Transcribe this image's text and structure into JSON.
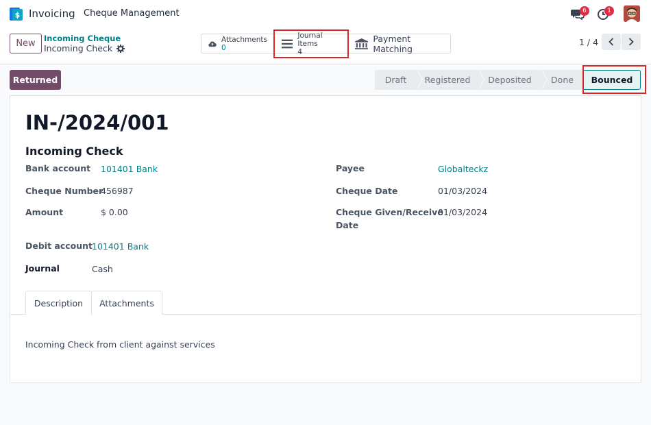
{
  "navbar": {
    "app_name": "Invoicing",
    "menu": [
      "Cheque Management"
    ],
    "messages_count": "6",
    "activities_count": "1"
  },
  "control": {
    "new_label": "New",
    "breadcrumb_parent": "Incoming Cheque",
    "breadcrumb_current": "Incoming Check",
    "smart_buttons": {
      "attachments": {
        "label": "Attachments",
        "value": "0"
      },
      "journal_items": {
        "label": "Journal Items",
        "value": "4"
      },
      "payment_matching": {
        "label": "Payment Matching"
      }
    },
    "pager": "1 / 4"
  },
  "statusbar": {
    "action_button": "Returned",
    "stages": [
      "Draft",
      "Registered",
      "Deposited",
      "Done"
    ],
    "active_stage": "Bounced"
  },
  "form": {
    "title": "IN-/2024/001",
    "subtitle": "Incoming Check",
    "fields": {
      "bank_account": {
        "label": "Bank account",
        "value": "101401 Bank"
      },
      "cheque_number": {
        "label": "Cheque Number",
        "value": "456987"
      },
      "amount": {
        "label": "Amount",
        "value": "$ 0.00"
      },
      "payee": {
        "label": "Payee",
        "value": "Globalteckz"
      },
      "cheque_date": {
        "label": "Cheque Date",
        "value": "01/03/2024"
      },
      "cheque_given_date": {
        "label_line1": "Cheque Given/Receive",
        "label_line2": "Date",
        "value": "01/03/2024"
      },
      "debit_account": {
        "label": "Debit account",
        "value": "101401 Bank"
      },
      "journal": {
        "label": "Journal",
        "value": "Cash"
      }
    },
    "tabs": [
      "Description",
      "Attachments"
    ],
    "description": "Incoming Check from client against services"
  },
  "colors": {
    "primary": "#714b67",
    "link": "#017e84",
    "highlight": "#dc2626",
    "badge": "#e02d47"
  }
}
